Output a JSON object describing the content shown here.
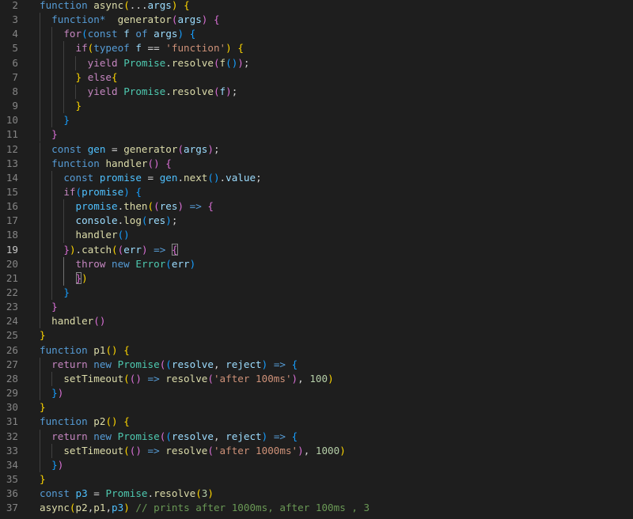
{
  "editor": {
    "language": "javascript",
    "active_line": 19,
    "lines": [
      {
        "n": "2",
        "tokens": [
          [
            "function",
            "kw"
          ],
          [
            " ",
            "p"
          ],
          [
            "async",
            "fn"
          ],
          [
            "(",
            "b1"
          ],
          [
            "...",
            "p"
          ],
          [
            "args",
            "var"
          ],
          [
            ")",
            "b1"
          ],
          [
            " ",
            "p"
          ],
          [
            "{",
            "b1"
          ]
        ]
      },
      {
        "n": "3",
        "tokens": [
          [
            "  ",
            "p"
          ],
          [
            "function",
            "kw"
          ],
          [
            "*",
            "op"
          ],
          [
            "  ",
            "p"
          ],
          [
            "generator",
            "fn"
          ],
          [
            "(",
            "b2"
          ],
          [
            "args",
            "var"
          ],
          [
            ")",
            "b2"
          ],
          [
            " ",
            "p"
          ],
          [
            "{",
            "b2"
          ]
        ]
      },
      {
        "n": "4",
        "tokens": [
          [
            "    ",
            "p"
          ],
          [
            "for",
            "kw2"
          ],
          [
            "(",
            "b3"
          ],
          [
            "const",
            "kw"
          ],
          [
            " ",
            "p"
          ],
          [
            "f",
            "var"
          ],
          [
            " ",
            "p"
          ],
          [
            "of",
            "kw"
          ],
          [
            " ",
            "p"
          ],
          [
            "args",
            "var"
          ],
          [
            ")",
            "b3"
          ],
          [
            " ",
            "p"
          ],
          [
            "{",
            "b3"
          ]
        ]
      },
      {
        "n": "5",
        "tokens": [
          [
            "      ",
            "p"
          ],
          [
            "if",
            "kw2"
          ],
          [
            "(",
            "b1"
          ],
          [
            "typeof",
            "kw"
          ],
          [
            " ",
            "p"
          ],
          [
            "f",
            "var"
          ],
          [
            " == ",
            "p"
          ],
          [
            "'function'",
            "str"
          ],
          [
            ")",
            "b1"
          ],
          [
            " ",
            "p"
          ],
          [
            "{",
            "b1"
          ]
        ]
      },
      {
        "n": "6",
        "tokens": [
          [
            "        ",
            "p"
          ],
          [
            "yield",
            "kw2"
          ],
          [
            " ",
            "p"
          ],
          [
            "Promise",
            "cls"
          ],
          [
            ".",
            "p"
          ],
          [
            "resolve",
            "fn"
          ],
          [
            "(",
            "b2"
          ],
          [
            "f",
            "fn"
          ],
          [
            "()",
            "b3"
          ],
          [
            ")",
            "b2"
          ],
          [
            ";",
            "p"
          ]
        ]
      },
      {
        "n": "7",
        "tokens": [
          [
            "      ",
            "p"
          ],
          [
            "}",
            "b1"
          ],
          [
            " ",
            "p"
          ],
          [
            "else",
            "kw2"
          ],
          [
            "{",
            "b1"
          ]
        ]
      },
      {
        "n": "8",
        "tokens": [
          [
            "        ",
            "p"
          ],
          [
            "yield",
            "kw2"
          ],
          [
            " ",
            "p"
          ],
          [
            "Promise",
            "cls"
          ],
          [
            ".",
            "p"
          ],
          [
            "resolve",
            "fn"
          ],
          [
            "(",
            "b2"
          ],
          [
            "f",
            "var"
          ],
          [
            ")",
            "b2"
          ],
          [
            ";",
            "p"
          ]
        ]
      },
      {
        "n": "9",
        "tokens": [
          [
            "      ",
            "p"
          ],
          [
            "}",
            "b1"
          ]
        ]
      },
      {
        "n": "10",
        "tokens": [
          [
            "    ",
            "p"
          ],
          [
            "}",
            "b3"
          ]
        ]
      },
      {
        "n": "11",
        "tokens": [
          [
            "  ",
            "p"
          ],
          [
            "}",
            "b2"
          ]
        ]
      },
      {
        "n": "12",
        "tokens": [
          [
            "  ",
            "p"
          ],
          [
            "const",
            "kw"
          ],
          [
            " ",
            "p"
          ],
          [
            "gen",
            "const"
          ],
          [
            " = ",
            "p"
          ],
          [
            "generator",
            "fn"
          ],
          [
            "(",
            "b2"
          ],
          [
            "args",
            "var"
          ],
          [
            ")",
            "b2"
          ],
          [
            ";",
            "p"
          ]
        ]
      },
      {
        "n": "13",
        "tokens": [
          [
            "  ",
            "p"
          ],
          [
            "function",
            "kw"
          ],
          [
            " ",
            "p"
          ],
          [
            "handler",
            "fn"
          ],
          [
            "()",
            "b2"
          ],
          [
            " ",
            "p"
          ],
          [
            "{",
            "b2"
          ]
        ]
      },
      {
        "n": "14",
        "tokens": [
          [
            "    ",
            "p"
          ],
          [
            "const",
            "kw"
          ],
          [
            " ",
            "p"
          ],
          [
            "promise",
            "const"
          ],
          [
            " = ",
            "p"
          ],
          [
            "gen",
            "const"
          ],
          [
            ".",
            "p"
          ],
          [
            "next",
            "fn"
          ],
          [
            "()",
            "b3"
          ],
          [
            ".",
            "p"
          ],
          [
            "value",
            "var"
          ],
          [
            ";",
            "p"
          ]
        ]
      },
      {
        "n": "15",
        "tokens": [
          [
            "    ",
            "p"
          ],
          [
            "if",
            "kw2"
          ],
          [
            "(",
            "b3"
          ],
          [
            "promise",
            "const"
          ],
          [
            ")",
            "b3"
          ],
          [
            " ",
            "p"
          ],
          [
            "{",
            "b3"
          ]
        ]
      },
      {
        "n": "16",
        "tokens": [
          [
            "      ",
            "p"
          ],
          [
            "promise",
            "const"
          ],
          [
            ".",
            "p"
          ],
          [
            "then",
            "fn"
          ],
          [
            "(",
            "b1"
          ],
          [
            "(",
            "b2"
          ],
          [
            "res",
            "var"
          ],
          [
            ")",
            "b2"
          ],
          [
            " ",
            "p"
          ],
          [
            "=>",
            "kw"
          ],
          [
            " ",
            "p"
          ],
          [
            "{",
            "b2"
          ]
        ]
      },
      {
        "n": "17",
        "tokens": [
          [
            "      ",
            "p"
          ],
          [
            "console",
            "var"
          ],
          [
            ".",
            "p"
          ],
          [
            "log",
            "fn"
          ],
          [
            "(",
            "b3"
          ],
          [
            "res",
            "var"
          ],
          [
            ")",
            "b3"
          ],
          [
            ";",
            "p"
          ]
        ]
      },
      {
        "n": "18",
        "tokens": [
          [
            "      ",
            "p"
          ],
          [
            "handler",
            "fn"
          ],
          [
            "()",
            "b3"
          ]
        ]
      },
      {
        "n": "19",
        "tokens": [
          [
            "    ",
            "p"
          ],
          [
            "}",
            "b2"
          ],
          [
            ")",
            "b1"
          ],
          [
            ".",
            "p"
          ],
          [
            "catch",
            "fn"
          ],
          [
            "(",
            "b1"
          ],
          [
            "(",
            "b2"
          ],
          [
            "err",
            "var"
          ],
          [
            ")",
            "b2"
          ],
          [
            " ",
            "p"
          ],
          [
            "=>",
            "kw"
          ],
          [
            " ",
            "p"
          ],
          [
            "{",
            "b2m"
          ]
        ]
      },
      {
        "n": "20",
        "tokens": [
          [
            "      ",
            "p"
          ],
          [
            "throw",
            "kw2"
          ],
          [
            " ",
            "p"
          ],
          [
            "new",
            "kw"
          ],
          [
            " ",
            "p"
          ],
          [
            "Error",
            "cls"
          ],
          [
            "(",
            "b3"
          ],
          [
            "err",
            "var"
          ],
          [
            ")",
            "b3"
          ]
        ]
      },
      {
        "n": "21",
        "tokens": [
          [
            "      ",
            "p"
          ],
          [
            "}",
            "b2m"
          ],
          [
            ")",
            "b1"
          ]
        ]
      },
      {
        "n": "22",
        "tokens": [
          [
            "    ",
            "p"
          ],
          [
            "}",
            "b3"
          ]
        ]
      },
      {
        "n": "23",
        "tokens": [
          [
            "  ",
            "p"
          ],
          [
            "}",
            "b2"
          ]
        ]
      },
      {
        "n": "24",
        "tokens": [
          [
            "  ",
            "p"
          ],
          [
            "handler",
            "fn"
          ],
          [
            "()",
            "b2"
          ]
        ]
      },
      {
        "n": "25",
        "tokens": [
          [
            "}",
            "b1"
          ]
        ]
      },
      {
        "n": "26",
        "tokens": [
          [
            "function",
            "kw"
          ],
          [
            " ",
            "p"
          ],
          [
            "p1",
            "fn"
          ],
          [
            "()",
            "b1"
          ],
          [
            " ",
            "p"
          ],
          [
            "{",
            "b1"
          ]
        ]
      },
      {
        "n": "27",
        "tokens": [
          [
            "  ",
            "p"
          ],
          [
            "return",
            "kw2"
          ],
          [
            " ",
            "p"
          ],
          [
            "new",
            "kw"
          ],
          [
            " ",
            "p"
          ],
          [
            "Promise",
            "cls"
          ],
          [
            "(",
            "b2"
          ],
          [
            "(",
            "b3"
          ],
          [
            "resolve",
            "var"
          ],
          [
            ", ",
            "p"
          ],
          [
            "reject",
            "var"
          ],
          [
            ")",
            "b3"
          ],
          [
            " ",
            "p"
          ],
          [
            "=>",
            "kw"
          ],
          [
            " ",
            "p"
          ],
          [
            "{",
            "b3"
          ]
        ]
      },
      {
        "n": "28",
        "tokens": [
          [
            "    ",
            "p"
          ],
          [
            "setTimeout",
            "fn"
          ],
          [
            "(",
            "b1"
          ],
          [
            "()",
            "b2"
          ],
          [
            " ",
            "p"
          ],
          [
            "=>",
            "kw"
          ],
          [
            " ",
            "p"
          ],
          [
            "resolve",
            "fn"
          ],
          [
            "(",
            "b2"
          ],
          [
            "'after 100ms'",
            "str"
          ],
          [
            ")",
            "b2"
          ],
          [
            ", ",
            "p"
          ],
          [
            "100",
            "num"
          ],
          [
            ")",
            "b1"
          ]
        ]
      },
      {
        "n": "29",
        "tokens": [
          [
            "  ",
            "p"
          ],
          [
            "}",
            "b3"
          ],
          [
            ")",
            "b2"
          ]
        ]
      },
      {
        "n": "30",
        "tokens": [
          [
            "}",
            "b1"
          ]
        ]
      },
      {
        "n": "31",
        "tokens": [
          [
            "function",
            "kw"
          ],
          [
            " ",
            "p"
          ],
          [
            "p2",
            "fn"
          ],
          [
            "()",
            "b1"
          ],
          [
            " ",
            "p"
          ],
          [
            "{",
            "b1"
          ]
        ]
      },
      {
        "n": "32",
        "tokens": [
          [
            "  ",
            "p"
          ],
          [
            "return",
            "kw2"
          ],
          [
            " ",
            "p"
          ],
          [
            "new",
            "kw"
          ],
          [
            " ",
            "p"
          ],
          [
            "Promise",
            "cls"
          ],
          [
            "(",
            "b2"
          ],
          [
            "(",
            "b3"
          ],
          [
            "resolve",
            "var"
          ],
          [
            ", ",
            "p"
          ],
          [
            "reject",
            "var"
          ],
          [
            ")",
            "b3"
          ],
          [
            " ",
            "p"
          ],
          [
            "=>",
            "kw"
          ],
          [
            " ",
            "p"
          ],
          [
            "{",
            "b3"
          ]
        ]
      },
      {
        "n": "33",
        "tokens": [
          [
            "    ",
            "p"
          ],
          [
            "setTimeout",
            "fn"
          ],
          [
            "(",
            "b1"
          ],
          [
            "()",
            "b2"
          ],
          [
            " ",
            "p"
          ],
          [
            "=>",
            "kw"
          ],
          [
            " ",
            "p"
          ],
          [
            "resolve",
            "fn"
          ],
          [
            "(",
            "b2"
          ],
          [
            "'after 1000ms'",
            "str"
          ],
          [
            ")",
            "b2"
          ],
          [
            ", ",
            "p"
          ],
          [
            "1000",
            "num"
          ],
          [
            ")",
            "b1"
          ]
        ]
      },
      {
        "n": "34",
        "tokens": [
          [
            "  ",
            "p"
          ],
          [
            "}",
            "b3"
          ],
          [
            ")",
            "b2"
          ]
        ]
      },
      {
        "n": "35",
        "tokens": [
          [
            "}",
            "b1"
          ]
        ]
      },
      {
        "n": "36",
        "tokens": [
          [
            "const",
            "kw"
          ],
          [
            " ",
            "p"
          ],
          [
            "p3",
            "const"
          ],
          [
            " = ",
            "p"
          ],
          [
            "Promise",
            "cls"
          ],
          [
            ".",
            "p"
          ],
          [
            "resolve",
            "fn"
          ],
          [
            "(",
            "b1"
          ],
          [
            "3",
            "num"
          ],
          [
            ")",
            "b1"
          ]
        ]
      },
      {
        "n": "37",
        "tokens": [
          [
            "async",
            "fn"
          ],
          [
            "(",
            "b1"
          ],
          [
            "p2",
            "fn"
          ],
          [
            ",",
            "p"
          ],
          [
            "p1",
            "fn"
          ],
          [
            ",",
            "p"
          ],
          [
            "p3",
            "const"
          ],
          [
            ")",
            "b1"
          ],
          [
            " ",
            "p"
          ],
          [
            "// prints after 1000ms, after 100ms , 3",
            "cmt"
          ]
        ]
      }
    ]
  },
  "theme": {
    "background": "#1e1e1e",
    "line_number": "#858585",
    "line_number_active": "#c6c6c6",
    "plain": "#d4d4d4",
    "keyword": "#569cd6",
    "control_keyword": "#c586c0",
    "function": "#dcdcaa",
    "variable": "#9cdcfe",
    "constant": "#4fc1ff",
    "class": "#4ec9b0",
    "string": "#ce9178",
    "number": "#b5cea8",
    "comment": "#6a9955",
    "bracket_1": "#ffd700",
    "bracket_2": "#da70d6",
    "bracket_3": "#179fff"
  }
}
